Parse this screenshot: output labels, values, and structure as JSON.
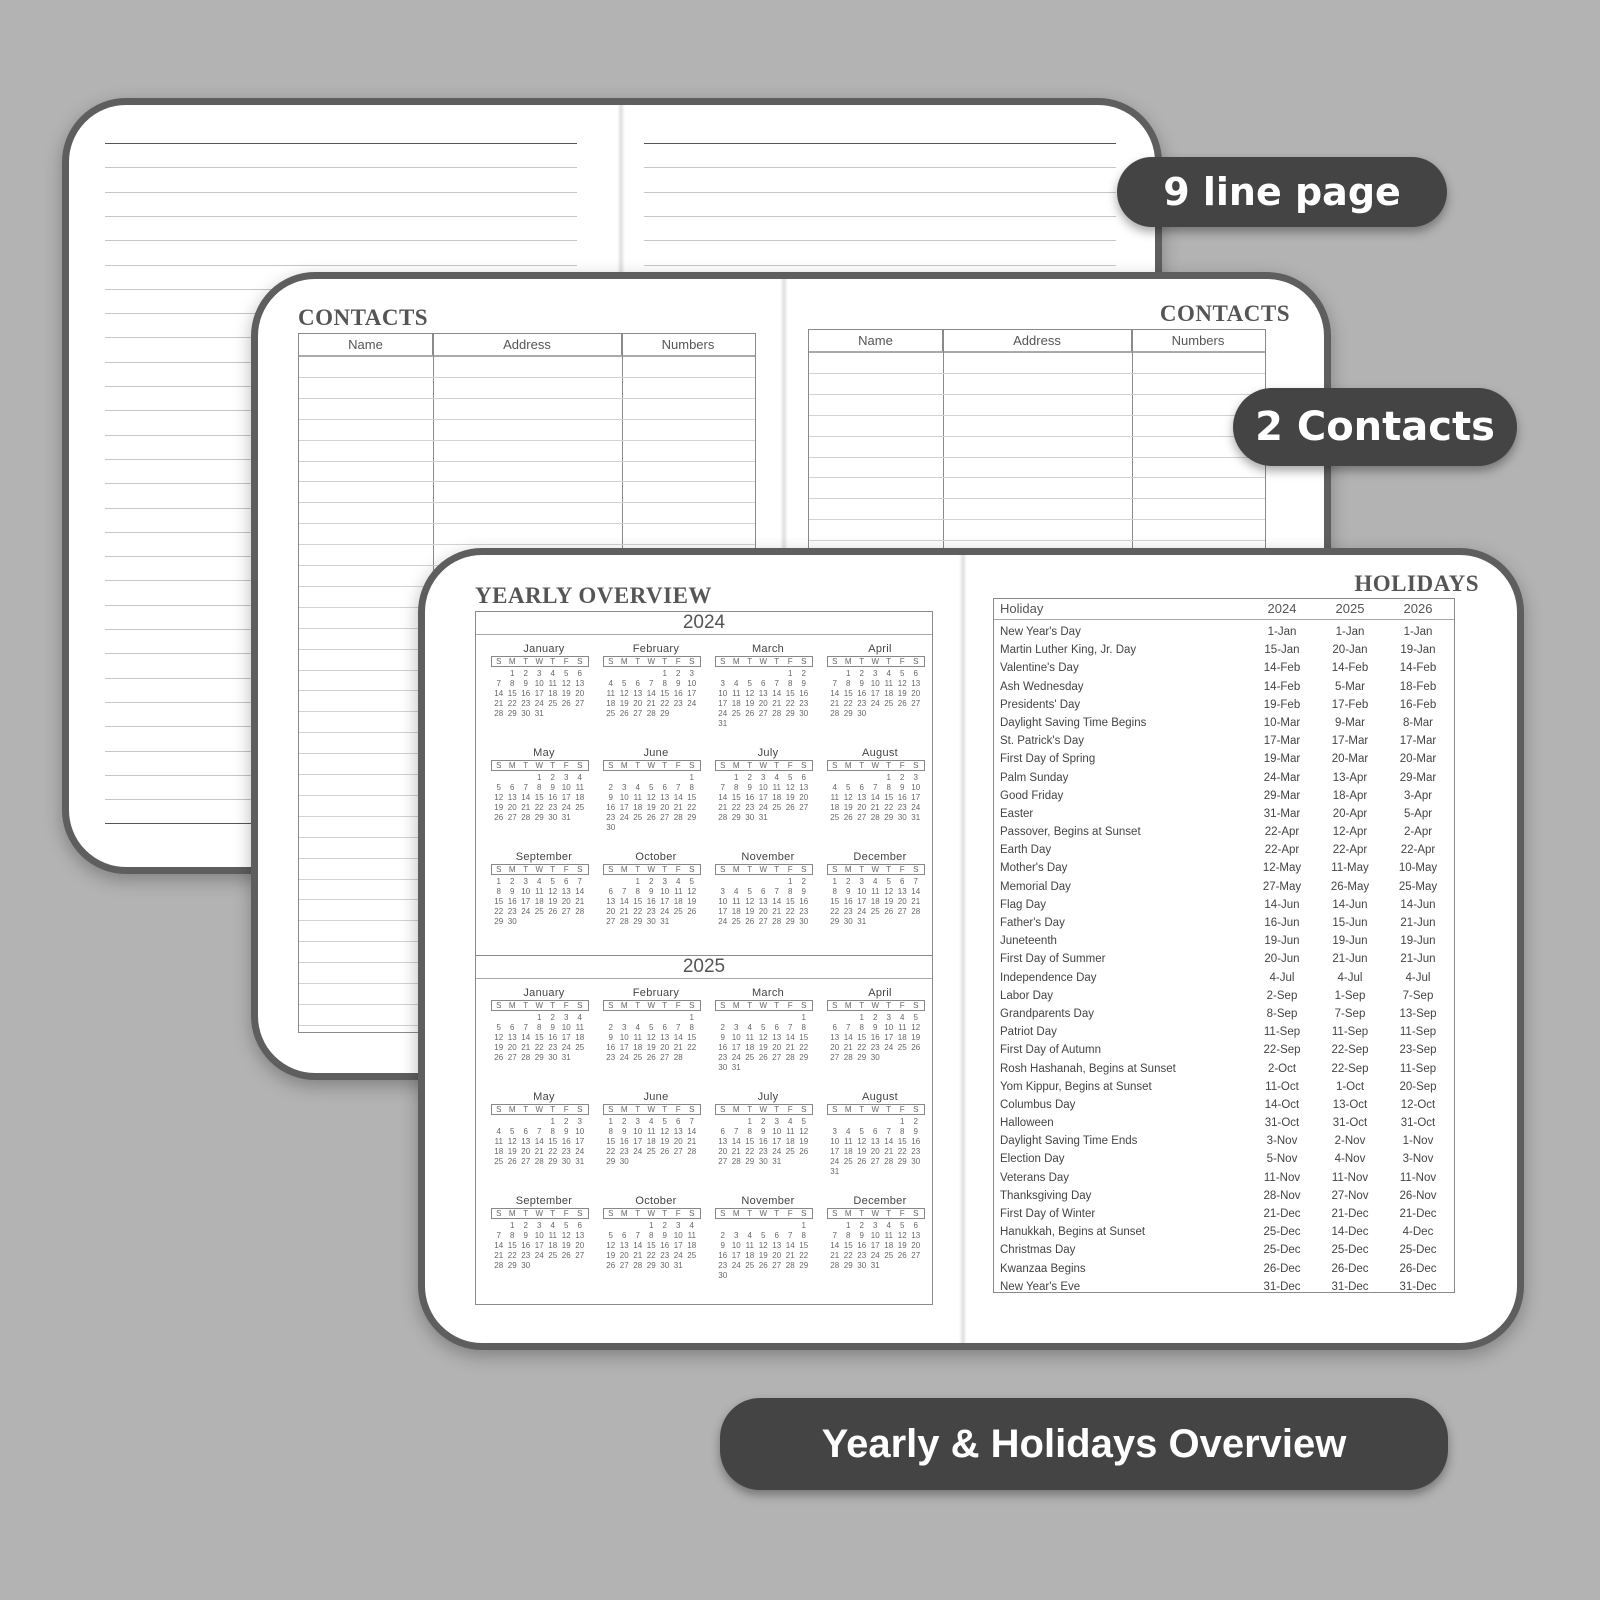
{
  "badges": {
    "lines": "9 line page",
    "contacts": "2 Contacts",
    "yearly": "Yearly & Holidays Overview"
  },
  "contacts": {
    "title": "CONTACTS",
    "columns": [
      "Name",
      "Address",
      "Numbers"
    ]
  },
  "yearly": {
    "title": "YEARLY OVERVIEW",
    "weekday_header": [
      "S",
      "M",
      "T",
      "W",
      "T",
      "F",
      "S"
    ],
    "years": [
      {
        "year": "2024",
        "months": [
          {
            "name": "January",
            "start": 1,
            "days": 31
          },
          {
            "name": "February",
            "start": 4,
            "days": 29
          },
          {
            "name": "March",
            "start": 5,
            "days": 31
          },
          {
            "name": "April",
            "start": 1,
            "days": 30
          },
          {
            "name": "May",
            "start": 3,
            "days": 31
          },
          {
            "name": "June",
            "start": 6,
            "days": 30
          },
          {
            "name": "July",
            "start": 1,
            "days": 31
          },
          {
            "name": "August",
            "start": 4,
            "days": 31
          },
          {
            "name": "September",
            "start": 0,
            "days": 30
          },
          {
            "name": "October",
            "start": 2,
            "days": 31
          },
          {
            "name": "November",
            "start": 5,
            "days": 30
          },
          {
            "name": "December",
            "start": 0,
            "days": 31
          }
        ]
      },
      {
        "year": "2025",
        "months": [
          {
            "name": "January",
            "start": 3,
            "days": 31
          },
          {
            "name": "February",
            "start": 6,
            "days": 28
          },
          {
            "name": "March",
            "start": 6,
            "days": 31
          },
          {
            "name": "April",
            "start": 2,
            "days": 30
          },
          {
            "name": "May",
            "start": 4,
            "days": 31
          },
          {
            "name": "June",
            "start": 0,
            "days": 30
          },
          {
            "name": "July",
            "start": 2,
            "days": 31
          },
          {
            "name": "August",
            "start": 5,
            "days": 31
          },
          {
            "name": "September",
            "start": 1,
            "days": 30
          },
          {
            "name": "October",
            "start": 3,
            "days": 31
          },
          {
            "name": "November",
            "start": 6,
            "days": 30
          },
          {
            "name": "December",
            "start": 1,
            "days": 31
          }
        ]
      }
    ]
  },
  "holidays": {
    "title": "HOLIDAYS",
    "columns": [
      "Holiday",
      "2024",
      "2025",
      "2026"
    ],
    "rows": [
      [
        "New Year's Day",
        "1-Jan",
        "1-Jan",
        "1-Jan"
      ],
      [
        "Martin Luther King, Jr. Day",
        "15-Jan",
        "20-Jan",
        "19-Jan"
      ],
      [
        "Valentine's Day",
        "14-Feb",
        "14-Feb",
        "14-Feb"
      ],
      [
        "Ash Wednesday",
        "14-Feb",
        "5-Mar",
        "18-Feb"
      ],
      [
        "Presidents' Day",
        "19-Feb",
        "17-Feb",
        "16-Feb"
      ],
      [
        "Daylight Saving Time Begins",
        "10-Mar",
        "9-Mar",
        "8-Mar"
      ],
      [
        "St. Patrick's Day",
        "17-Mar",
        "17-Mar",
        "17-Mar"
      ],
      [
        "First Day of Spring",
        "19-Mar",
        "20-Mar",
        "20-Mar"
      ],
      [
        "Palm Sunday",
        "24-Mar",
        "13-Apr",
        "29-Mar"
      ],
      [
        "Good Friday",
        "29-Mar",
        "18-Apr",
        "3-Apr"
      ],
      [
        "Easter",
        "31-Mar",
        "20-Apr",
        "5-Apr"
      ],
      [
        "Passover, Begins at Sunset",
        "22-Apr",
        "12-Apr",
        "2-Apr"
      ],
      [
        "Earth Day",
        "22-Apr",
        "22-Apr",
        "22-Apr"
      ],
      [
        "Mother's Day",
        "12-May",
        "11-May",
        "10-May"
      ],
      [
        "Memorial Day",
        "27-May",
        "26-May",
        "25-May"
      ],
      [
        "Flag Day",
        "14-Jun",
        "14-Jun",
        "14-Jun"
      ],
      [
        "Father's Day",
        "16-Jun",
        "15-Jun",
        "21-Jun"
      ],
      [
        "Juneteenth",
        "19-Jun",
        "19-Jun",
        "19-Jun"
      ],
      [
        "First Day of Summer",
        "20-Jun",
        "21-Jun",
        "21-Jun"
      ],
      [
        "Independence Day",
        "4-Jul",
        "4-Jul",
        "4-Jul"
      ],
      [
        "Labor Day",
        "2-Sep",
        "1-Sep",
        "7-Sep"
      ],
      [
        "Grandparents Day",
        "8-Sep",
        "7-Sep",
        "13-Sep"
      ],
      [
        "Patriot Day",
        "11-Sep",
        "11-Sep",
        "11-Sep"
      ],
      [
        "First Day of Autumn",
        "22-Sep",
        "22-Sep",
        "23-Sep"
      ],
      [
        "Rosh Hashanah, Begins at Sunset",
        "2-Oct",
        "22-Sep",
        "11-Sep"
      ],
      [
        "Yom Kippur, Begins at Sunset",
        "11-Oct",
        "1-Oct",
        "20-Sep"
      ],
      [
        "Columbus Day",
        "14-Oct",
        "13-Oct",
        "12-Oct"
      ],
      [
        "Halloween",
        "31-Oct",
        "31-Oct",
        "31-Oct"
      ],
      [
        "Daylight Saving Time Ends",
        "3-Nov",
        "2-Nov",
        "1-Nov"
      ],
      [
        "Election Day",
        "5-Nov",
        "4-Nov",
        "3-Nov"
      ],
      [
        "Veterans Day",
        "11-Nov",
        "11-Nov",
        "11-Nov"
      ],
      [
        "Thanksgiving Day",
        "28-Nov",
        "27-Nov",
        "26-Nov"
      ],
      [
        "First Day of Winter",
        "21-Dec",
        "21-Dec",
        "21-Dec"
      ],
      [
        "Hanukkah, Begins at Sunset",
        "25-Dec",
        "14-Dec",
        "4-Dec"
      ],
      [
        "Christmas Day",
        "25-Dec",
        "25-Dec",
        "25-Dec"
      ],
      [
        "Kwanzaa Begins",
        "26-Dec",
        "26-Dec",
        "26-Dec"
      ],
      [
        "New Year's Eve",
        "31-Dec",
        "31-Dec",
        "31-Dec"
      ]
    ]
  }
}
